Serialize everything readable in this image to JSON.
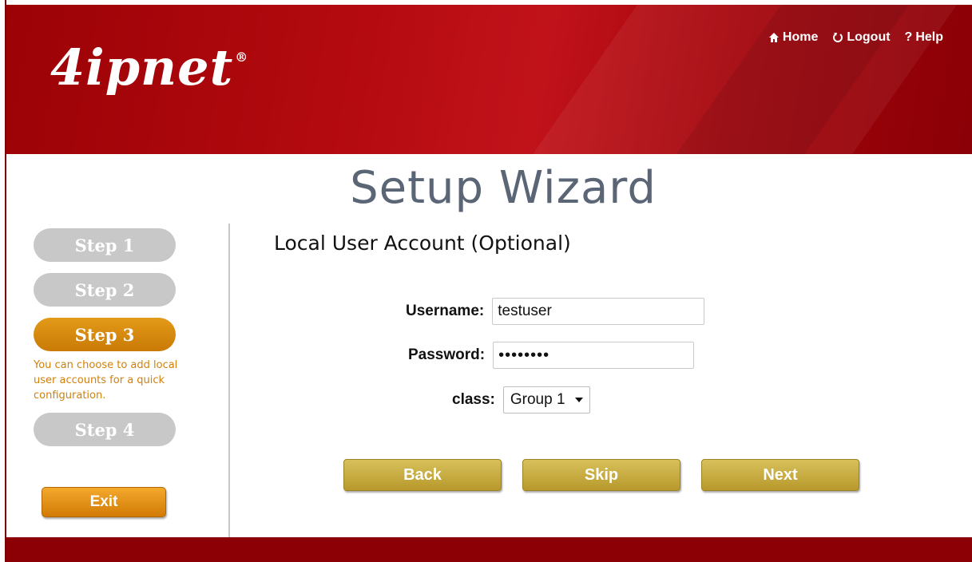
{
  "header": {
    "logo_text": "4ipnet",
    "logo_mark": "®",
    "nav": [
      {
        "label": "Home",
        "icon": "home-icon"
      },
      {
        "label": "Logout",
        "icon": "logout-icon"
      },
      {
        "label": "Help",
        "icon": "help-icon"
      }
    ]
  },
  "page": {
    "title": "Setup Wizard",
    "subtitle": "Local User Account (Optional)"
  },
  "sidebar": {
    "steps": [
      {
        "label": "Step 1",
        "active": false
      },
      {
        "label": "Step 2",
        "active": false
      },
      {
        "label": "Step 3",
        "active": true
      },
      {
        "label": "Step 4",
        "active": false
      }
    ],
    "step_description": "You can choose to add local user accounts for a quick configuration.",
    "exit_label": "Exit"
  },
  "form": {
    "username_label": "Username:",
    "username_value": "testuser",
    "password_label": "Password:",
    "password_value": "••••••••",
    "class_label": "class:",
    "class_value": "Group 1"
  },
  "buttons": {
    "back": "Back",
    "skip": "Skip",
    "next": "Next"
  },
  "colors": {
    "header_red": "#b30a0f",
    "active_step": "#d98a0c",
    "inactive_step": "#c8c8c8",
    "action_gold": "#c8ab40",
    "title_gray": "#5a6575"
  }
}
